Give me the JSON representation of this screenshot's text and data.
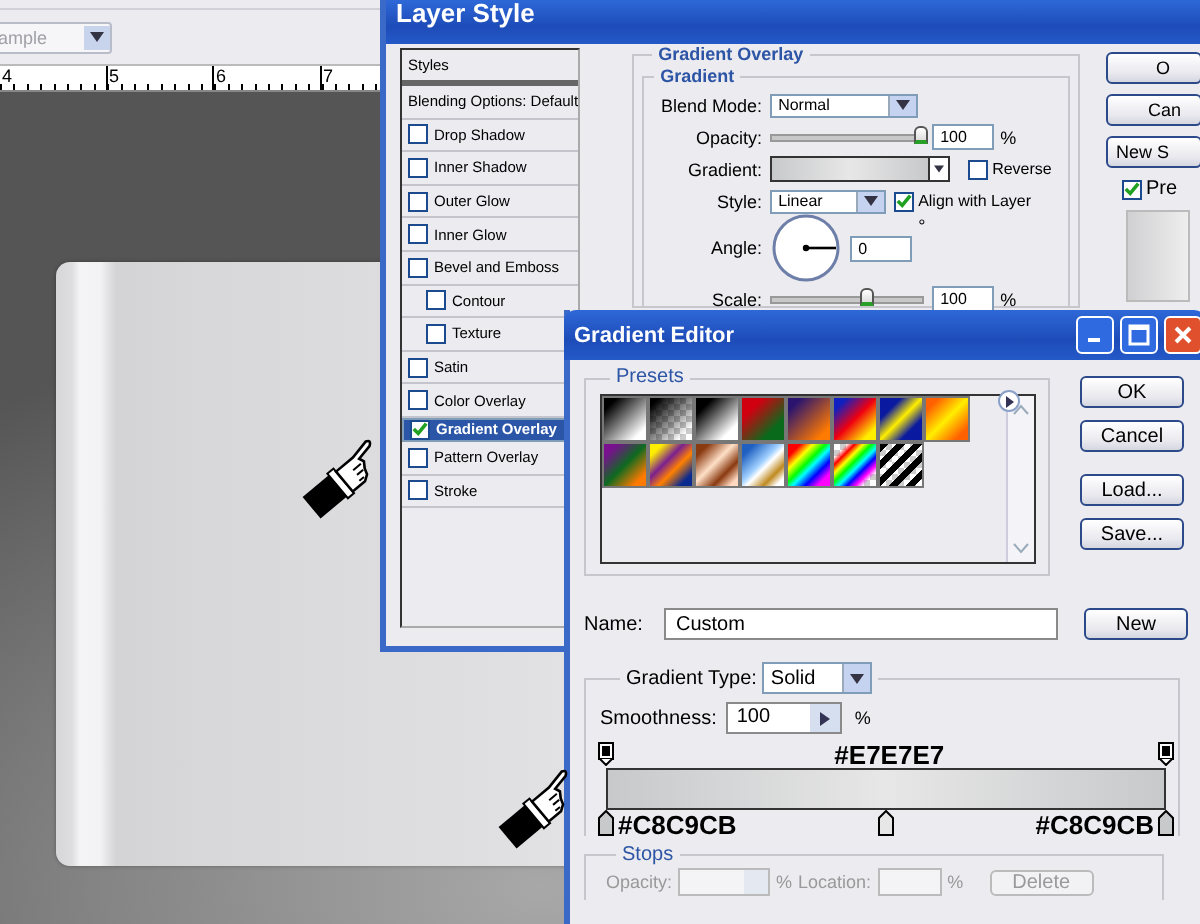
{
  "workspace": {
    "options_dropdown": "ample",
    "ruler_numbers": [
      "4",
      "5",
      "6",
      "7"
    ]
  },
  "layer_style": {
    "title": "Layer Style",
    "styles_list": [
      {
        "label": "Styles",
        "kind": "header"
      },
      {
        "label": "Blending Options: Default",
        "kind": "header"
      },
      {
        "label": "Drop Shadow",
        "kind": "option",
        "checked": false,
        "selected": false
      },
      {
        "label": "Inner Shadow",
        "kind": "option",
        "checked": false,
        "selected": false
      },
      {
        "label": "Outer Glow",
        "kind": "option",
        "checked": false,
        "selected": false
      },
      {
        "label": "Inner Glow",
        "kind": "option",
        "checked": false,
        "selected": false
      },
      {
        "label": "Bevel and Emboss",
        "kind": "option",
        "checked": false,
        "selected": false,
        "children": [
          {
            "label": "Contour",
            "kind": "option",
            "checked": false,
            "selected": false
          },
          {
            "label": "Texture",
            "kind": "option",
            "checked": false,
            "selected": false
          }
        ]
      },
      {
        "label": "Satin",
        "kind": "option",
        "checked": false,
        "selected": false
      },
      {
        "label": "Color Overlay",
        "kind": "option",
        "checked": false,
        "selected": false
      },
      {
        "label": "Gradient Overlay",
        "kind": "option",
        "checked": true,
        "selected": true
      },
      {
        "label": "Pattern Overlay",
        "kind": "option",
        "checked": false,
        "selected": false
      },
      {
        "label": "Stroke",
        "kind": "option",
        "checked": false,
        "selected": false
      }
    ],
    "gradient_overlay": {
      "title": "Gradient Overlay",
      "group": "Gradient",
      "blend_mode": {
        "label": "Blend Mode:",
        "value": "Normal"
      },
      "opacity": {
        "label": "Opacity:",
        "value": "100",
        "unit": "%",
        "level": 1
      },
      "gradient": {
        "label": "Gradient:"
      },
      "reverse": {
        "label": "Reverse",
        "checked": false
      },
      "style": {
        "label": "Style:",
        "value": "Linear"
      },
      "align_with_layer": {
        "label": "Align with Layer",
        "checked": true
      },
      "angle": {
        "label": "Angle:",
        "value": "0",
        "unit": "°"
      },
      "scale": {
        "label": "Scale:",
        "value": "100",
        "unit": "%",
        "level": 0.64
      }
    },
    "buttons": [
      "O",
      "Can",
      "New S"
    ],
    "preview": {
      "label": "Pre",
      "checked": true
    }
  },
  "gradient_editor": {
    "title": "Gradient Editor",
    "presets_label": "Presets",
    "buttons": [
      "OK",
      "Cancel",
      "Load...",
      "Save..."
    ],
    "name": {
      "label": "Name:",
      "value": "Custom"
    },
    "new_button": "New",
    "gradient_type": {
      "label": "Gradient Type:",
      "value": "Solid"
    },
    "smoothness": {
      "label": "Smoothness:",
      "value": "100",
      "unit": "%"
    },
    "opacity_stops": [
      {
        "level": 0
      },
      {
        "level": 1
      }
    ],
    "color_stops": [
      {
        "level": 0,
        "color": "#c8c9cb",
        "annotation": "#C8C9CB",
        "kind": "below"
      },
      {
        "level": 0.5,
        "color": "#e7e7e7",
        "annotation": "#E7E7E7",
        "kind": "above"
      },
      {
        "level": 1,
        "color": "#c8c9cb",
        "annotation": "#C8C9CB",
        "kind": "below"
      }
    ],
    "stops": {
      "label": "Stops",
      "disabled": true,
      "opacity_label": "Opacity:",
      "opacity_unit": "%",
      "location_label": "Location:",
      "location_unit": "%",
      "delete_button": "Delete"
    }
  }
}
